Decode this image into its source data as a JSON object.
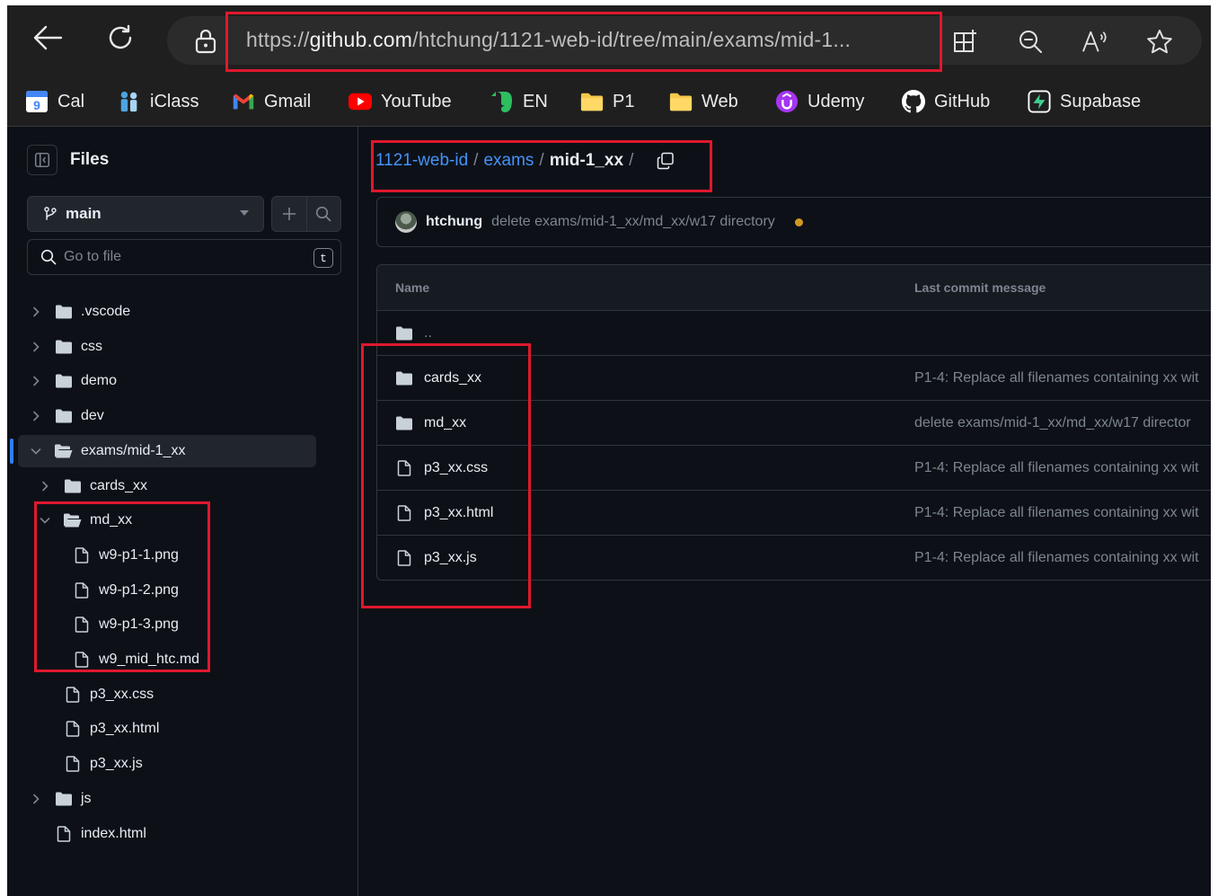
{
  "browser": {
    "url_prefix": "https://",
    "url_domain": "github.com",
    "url_path": "/htchung/1121-web-id/tree/main/exams/mid-1...",
    "bookmarks": [
      {
        "label": "Cal",
        "icon": "calendar-icon"
      },
      {
        "label": "iClass",
        "icon": "iclass-icon"
      },
      {
        "label": "Gmail",
        "icon": "gmail-icon"
      },
      {
        "label": "YouTube",
        "icon": "youtube-icon"
      },
      {
        "label": "EN",
        "icon": "evernote-icon"
      },
      {
        "label": "P1",
        "icon": "folder-icon"
      },
      {
        "label": "Web",
        "icon": "folder-icon"
      },
      {
        "label": "Udemy",
        "icon": "udemy-icon"
      },
      {
        "label": "GitHub",
        "icon": "github-icon"
      },
      {
        "label": "Supabase",
        "icon": "supabase-icon"
      }
    ],
    "calendar_number": "9"
  },
  "sidebar": {
    "title": "Files",
    "branch": "main",
    "search_placeholder": "Go to file",
    "search_shortcut": "t",
    "tree": [
      {
        "label": ".vscode",
        "type": "folder",
        "depth": 0,
        "state": "collapsed"
      },
      {
        "label": "css",
        "type": "folder",
        "depth": 0,
        "state": "collapsed"
      },
      {
        "label": "demo",
        "type": "folder",
        "depth": 0,
        "state": "collapsed"
      },
      {
        "label": "dev",
        "type": "folder",
        "depth": 0,
        "state": "collapsed"
      },
      {
        "label": "exams/mid-1_xx",
        "type": "folder",
        "depth": 0,
        "state": "expanded",
        "selected": true
      },
      {
        "label": "cards_xx",
        "type": "folder",
        "depth": 1,
        "state": "collapsed"
      },
      {
        "label": "md_xx",
        "type": "folder",
        "depth": 1,
        "state": "expanded"
      },
      {
        "label": "w9-p1-1.png",
        "type": "file",
        "depth": 2
      },
      {
        "label": "w9-p1-2.png",
        "type": "file",
        "depth": 2
      },
      {
        "label": "w9-p1-3.png",
        "type": "file",
        "depth": 2
      },
      {
        "label": "w9_mid_htc.md",
        "type": "file",
        "depth": 2
      },
      {
        "label": "p3_xx.css",
        "type": "file",
        "depth": 1
      },
      {
        "label": "p3_xx.html",
        "type": "file",
        "depth": 1
      },
      {
        "label": "p3_xx.js",
        "type": "file",
        "depth": 1
      },
      {
        "label": "js",
        "type": "folder",
        "depth": 0,
        "state": "collapsed"
      },
      {
        "label": "index.html",
        "type": "file",
        "depth": 0
      }
    ]
  },
  "main": {
    "breadcrumb": {
      "repo": "1121-web-id",
      "dir": "exams",
      "current": "mid-1_xx",
      "sep": "/"
    },
    "commit": {
      "author": "htchung",
      "message": "delete exams/mid-1_xx/md_xx/w17 directory",
      "status_color": "#d29922"
    },
    "table": {
      "col_name": "Name",
      "col_message": "Last commit message",
      "parent": "..",
      "rows": [
        {
          "name": "cards_xx",
          "type": "folder",
          "message": "P1-4: Replace all filenames containing xx wit"
        },
        {
          "name": "md_xx",
          "type": "folder",
          "message": "delete exams/mid-1_xx/md_xx/w17 director"
        },
        {
          "name": "p3_xx.css",
          "type": "file",
          "message": "P1-4: Replace all filenames containing xx wit"
        },
        {
          "name": "p3_xx.html",
          "type": "file",
          "message": "P1-4: Replace all filenames containing xx wit"
        },
        {
          "name": "p3_xx.js",
          "type": "file",
          "message": "P1-4: Replace all filenames containing xx wit"
        }
      ]
    }
  },
  "colors": {
    "page_bg": "#0d1117",
    "link": "#4493f8",
    "muted": "#7d8590",
    "annotation": "#e0182d",
    "folder": "#e6edf3"
  }
}
